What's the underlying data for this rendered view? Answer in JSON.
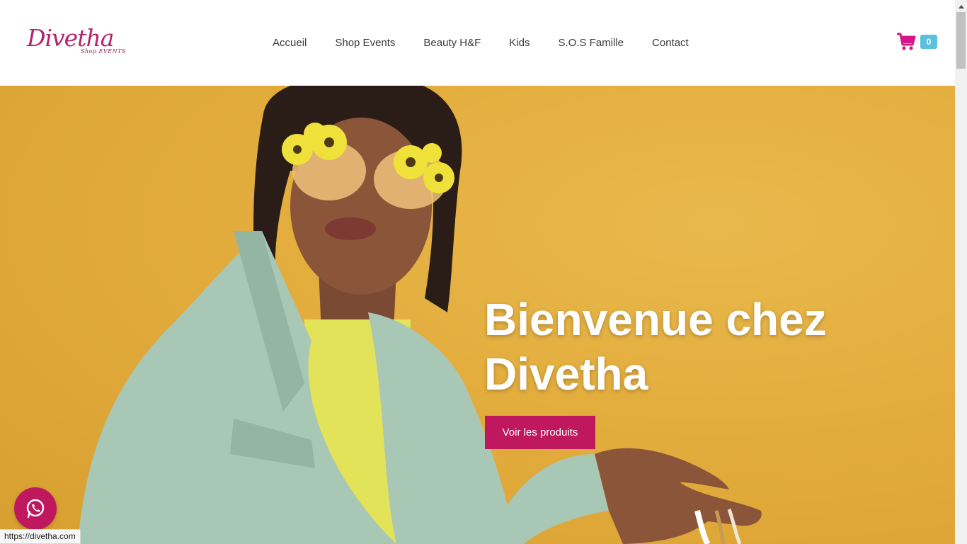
{
  "logo": {
    "main": "Divetha",
    "sub": "Shop EVENTS"
  },
  "nav": {
    "items": [
      {
        "label": "Accueil"
      },
      {
        "label": "Shop Events"
      },
      {
        "label": "Beauty H&F"
      },
      {
        "label": "Kids"
      },
      {
        "label": "S.O.S Famille"
      },
      {
        "label": "Contact"
      }
    ]
  },
  "cart": {
    "count": "0",
    "icon": "shopping-cart-icon"
  },
  "hero": {
    "title_line1": "Bienvenue chez",
    "title_line2": "Divetha",
    "button_label": "Voir les produits"
  },
  "whatsapp": {
    "icon": "whatsapp-icon"
  },
  "status_bar": {
    "url": "https://divetha.com"
  },
  "colors": {
    "brand": "#c0185f",
    "hero_bg": "#e2ac3c",
    "cart_icon": "#d4168a",
    "cart_badge": "#5bc0de",
    "jacket": "#a9c7b5",
    "top": "#e3e35a"
  }
}
